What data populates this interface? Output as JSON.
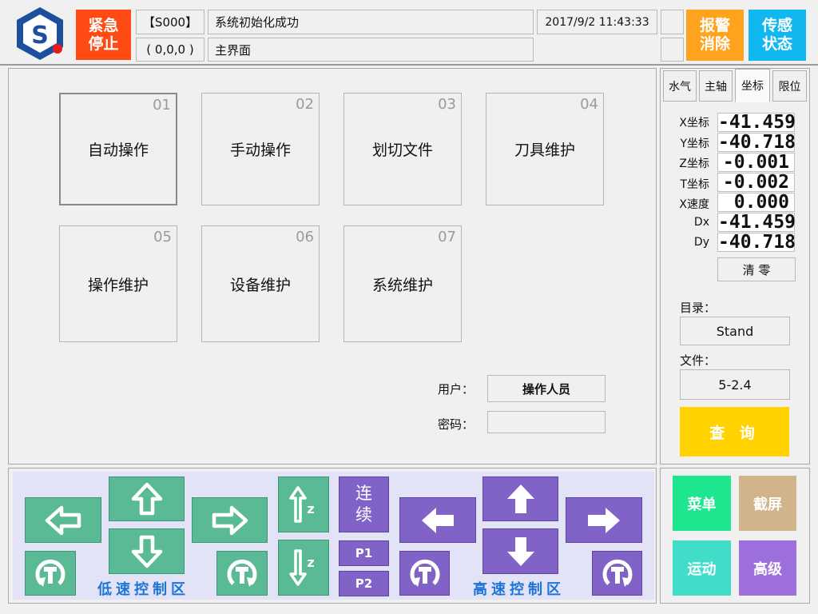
{
  "header": {
    "estop_line1": "紧急",
    "estop_line2": "停止",
    "status_code": "【S000】",
    "status_message": "系统初始化成功",
    "coords": "( 0,0,0 )",
    "screen_name": "主界面",
    "datetime": "2017/9/2 11:43:33",
    "alarm_line1": "报警",
    "alarm_line2": "消除",
    "sensor_line1": "传感",
    "sensor_line2": "状态"
  },
  "tiles": [
    {
      "num": "01",
      "label": "自动操作"
    },
    {
      "num": "02",
      "label": "手动操作"
    },
    {
      "num": "03",
      "label": "划切文件"
    },
    {
      "num": "04",
      "label": "刀具维护"
    },
    {
      "num": "05",
      "label": "操作维护"
    },
    {
      "num": "06",
      "label": "设备维护"
    },
    {
      "num": "07",
      "label": "系统维护"
    }
  ],
  "login": {
    "user_label": "用户：",
    "user_value": "操作人员",
    "password_label": "密码："
  },
  "tabs": [
    "水气",
    "主轴",
    "坐标",
    "限位"
  ],
  "readouts": [
    {
      "label": "X坐标",
      "value": "-41.459"
    },
    {
      "label": "Y坐标",
      "value": "-40.718"
    },
    {
      "label": "Z坐标",
      "value": "-0.001"
    },
    {
      "label": "T坐标",
      "value": "-0.002"
    },
    {
      "label": "X速度",
      "value": "0.000"
    },
    {
      "label": "Dx",
      "value": "-41.459"
    },
    {
      "label": "Dy",
      "value": "-40.718"
    }
  ],
  "side": {
    "clear_label": "清 零",
    "dir_label": "目录：",
    "dir_value": "Stand",
    "file_label": "文件：",
    "file_value": "5-2.4",
    "query_label": "查 询"
  },
  "control": {
    "low_zone_label": "低速控制区",
    "high_zone_label": "高速控制区",
    "continuous_line1": "连",
    "continuous_line2": "续",
    "p1": "P1",
    "p2": "P2"
  },
  "bottom_buttons": {
    "menu": "菜单",
    "screenshot": "截屏",
    "motion": "运动",
    "advanced": "高级"
  },
  "colors": {
    "estop": "#ff4a13",
    "alarm": "#ffa21e",
    "sensor": "#11b8f0",
    "query": "#ffd200",
    "low_speed": "#5aba95",
    "high_speed": "#8162c6",
    "menu": "#1ee68f",
    "screenshot": "#d2b48c",
    "motion": "#40ddc9",
    "advanced": "#9c6fdc",
    "zone_label": "#1e73d6"
  }
}
